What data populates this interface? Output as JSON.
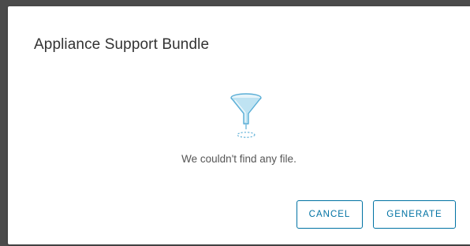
{
  "modal": {
    "title": "Appliance Support Bundle",
    "empty_state": {
      "icon": "funnel-icon",
      "message": "We couldn't find any file."
    },
    "footer": {
      "cancel_label": "CANCEL",
      "generate_label": "GENERATE"
    }
  },
  "colors": {
    "backdrop": "#4b4b4b",
    "modal_background": "#ffffff",
    "button_accent": "#0072a3",
    "icon_fill": "#bfe3f2",
    "icon_stroke": "#5aaed6"
  }
}
